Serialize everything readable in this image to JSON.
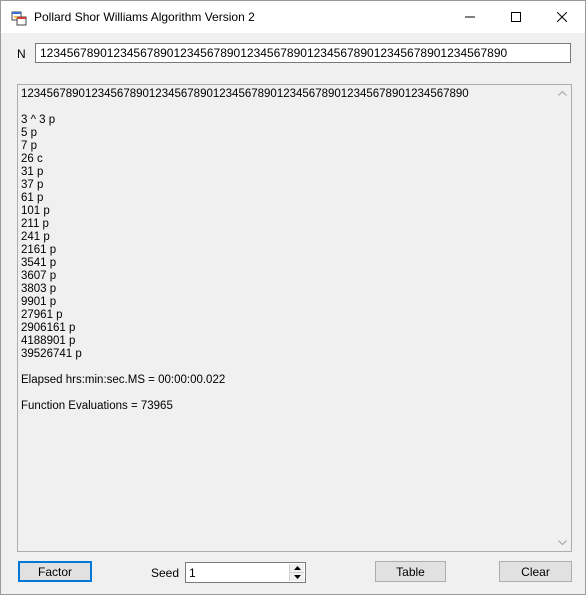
{
  "window": {
    "title": "Pollard Shor Williams Algorithm Version 2",
    "icons": {
      "app": "app-icon",
      "minimize": "minimize-icon",
      "maximize": "maximize-icon",
      "close": "close-icon"
    }
  },
  "n_field": {
    "label": "N",
    "value": "1234567890123456789012345678901234567890123456789012345678901234567890"
  },
  "output": {
    "number": "1234567890123456789012345678901234567890123456789012345678901234567890",
    "factors": [
      "3 ^ 3 p",
      "5 p",
      "7 p",
      "26 c",
      "31 p",
      "37 p",
      "61 p",
      "101 p",
      "211 p",
      "241 p",
      "2161 p",
      "3541 p",
      "3607 p",
      "3803 p",
      "9901 p",
      "27961 p",
      "2906161 p",
      "4188901 p",
      "39526741 p"
    ],
    "elapsed": "Elapsed hrs:min:sec.MS = 00:00:00.022",
    "evaluations": "Function Evaluations = 73965"
  },
  "bottom": {
    "factor_label": "Factor",
    "seed_label": "Seed",
    "seed_value": "1",
    "table_label": "Table",
    "clear_label": "Clear"
  }
}
